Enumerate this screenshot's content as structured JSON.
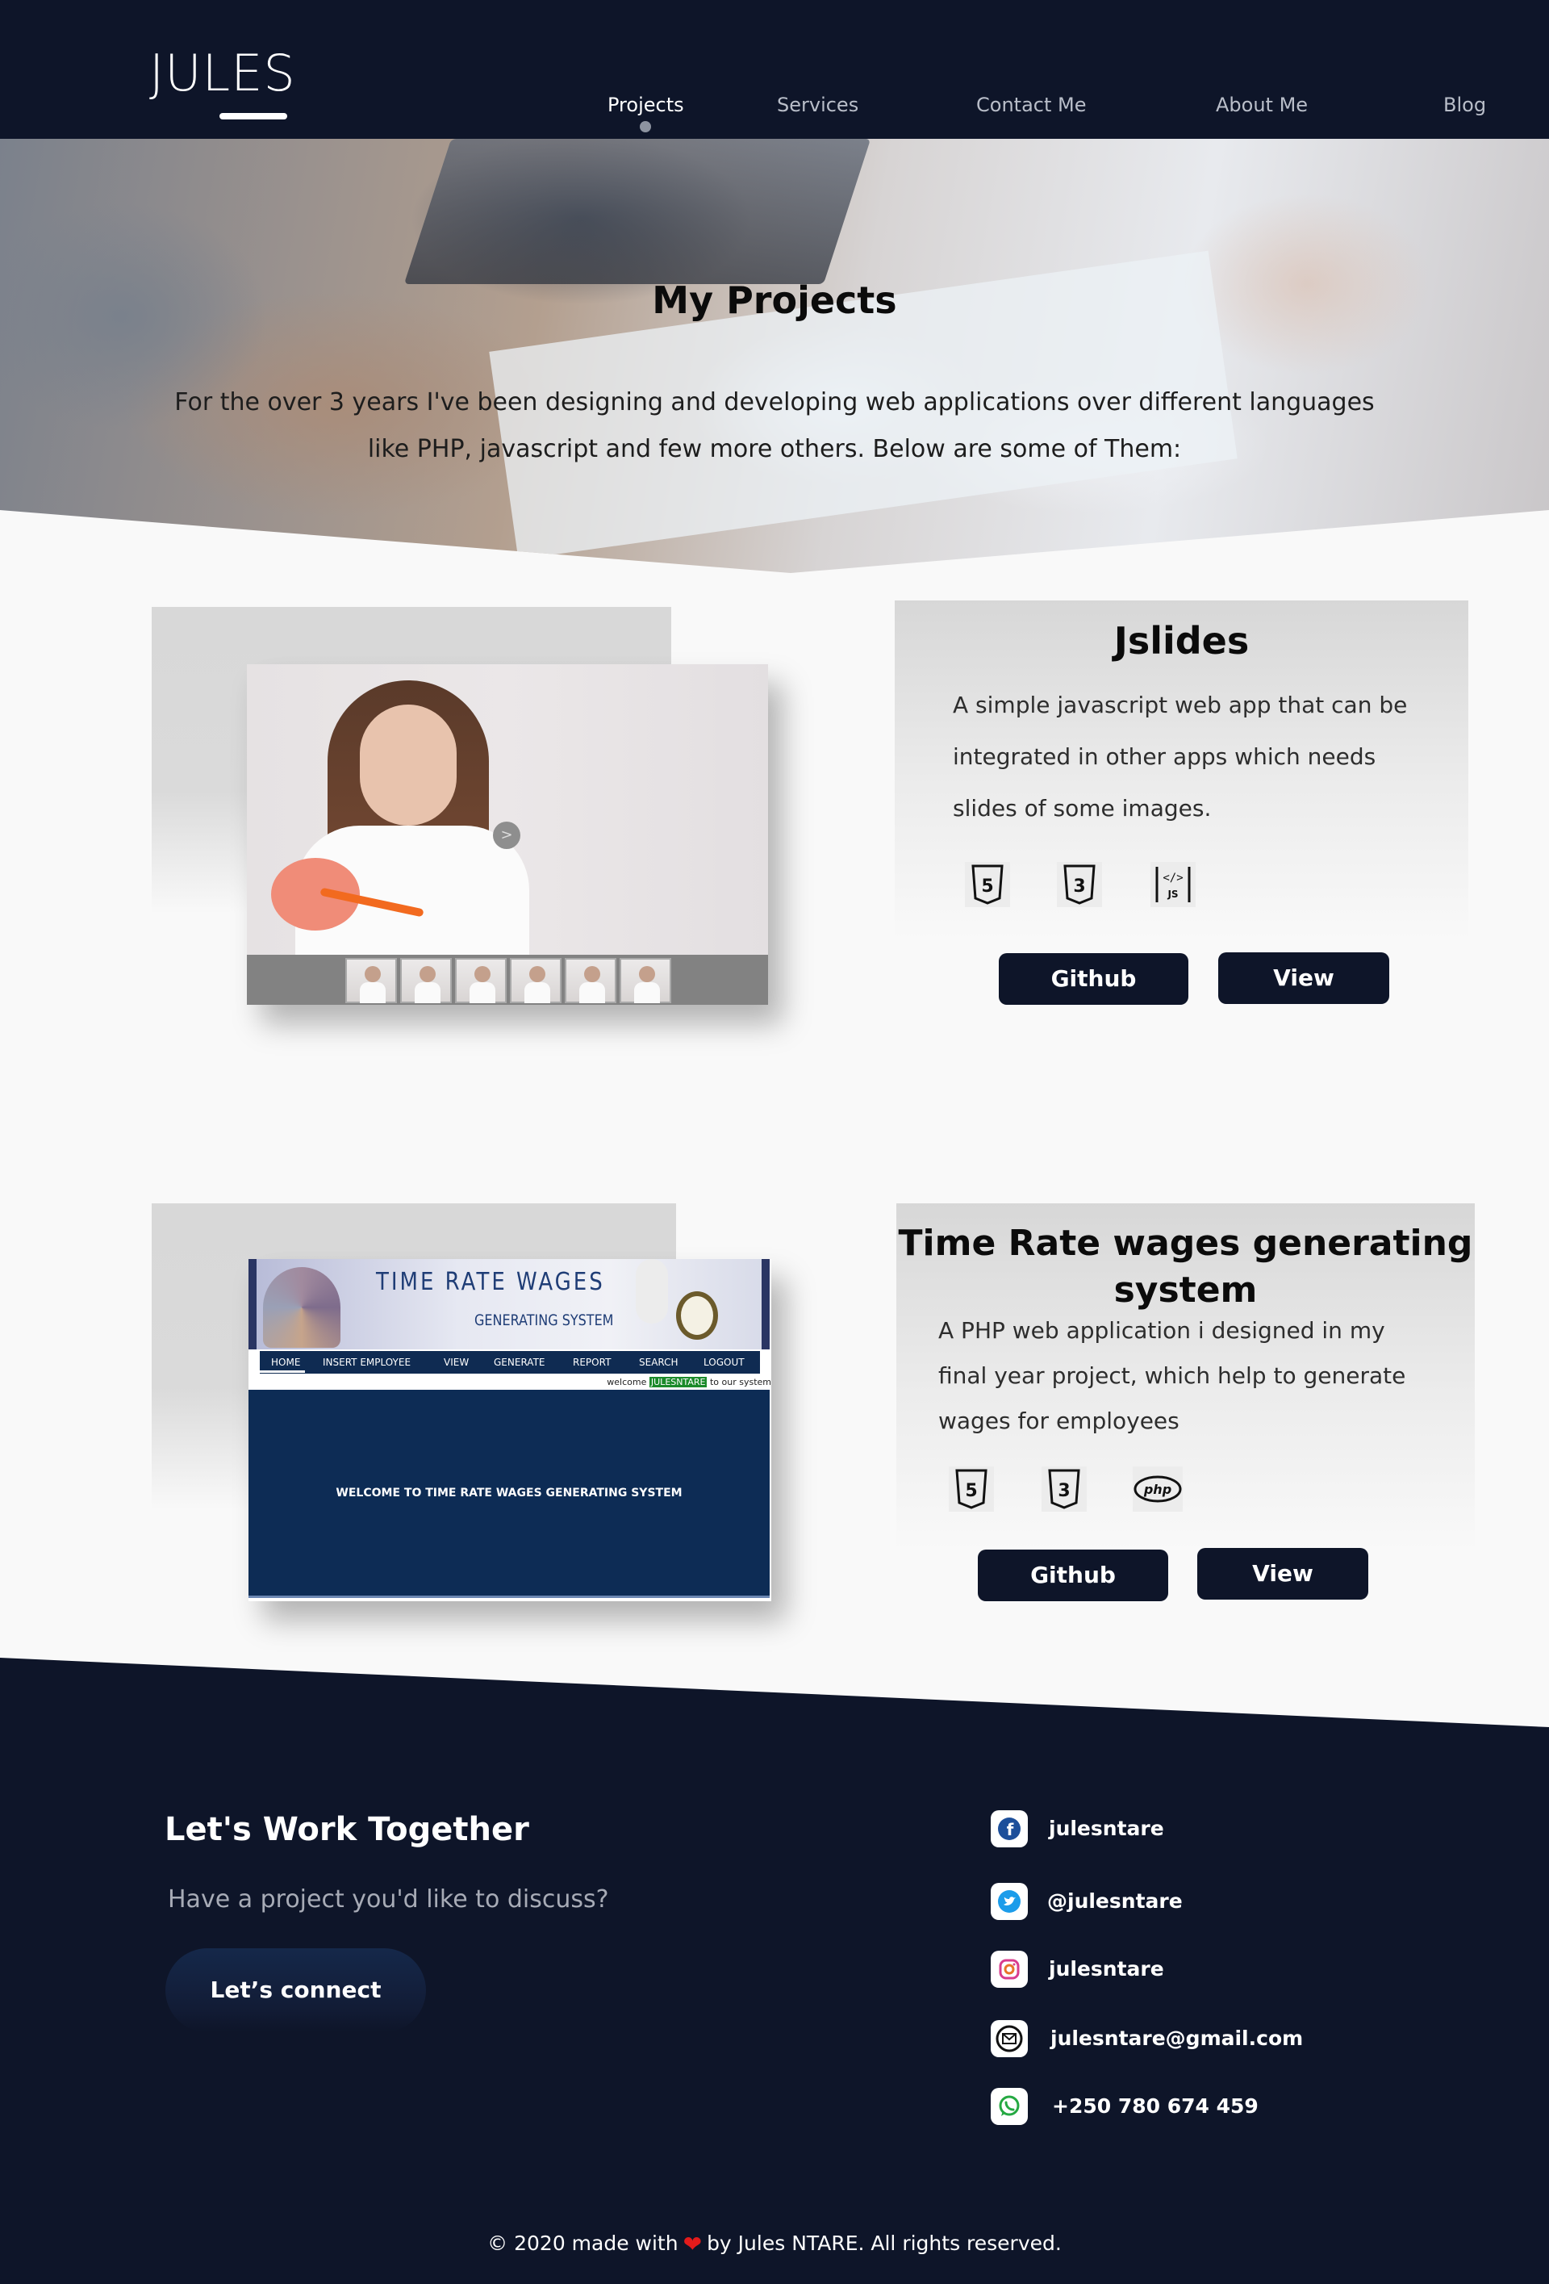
{
  "header": {
    "logo": "JULES",
    "nav": [
      {
        "label": "Projects",
        "active": true
      },
      {
        "label": "Services",
        "active": false
      },
      {
        "label": "Contact Me",
        "active": false
      },
      {
        "label": "About Me",
        "active": false
      },
      {
        "label": "Blog",
        "active": false
      }
    ]
  },
  "hero": {
    "title": "My Projects",
    "text_line1": "For the over 3 years I've been designing and developing web applications over different languages",
    "text_line2": "like PHP, javascript and few more others. Below are some of Them:"
  },
  "projects": [
    {
      "title": "Jslides",
      "description": [
        "A simple javascript web app that can be",
        "integrated in other apps which needs",
        "slides of some images."
      ],
      "tech": [
        "html5-icon",
        "css3-icon",
        "javascript-icon"
      ],
      "github_label": "Github",
      "view_label": "View"
    },
    {
      "title_line1": "Time Rate wages generating",
      "title_line2": "system",
      "description": [
        "A PHP web application i designed in my",
        "final year project, which help to generate",
        "wages for employees"
      ],
      "tech": [
        "html5-icon",
        "css3-icon",
        "php-icon"
      ],
      "github_label": "Github",
      "view_label": "View",
      "mockup": {
        "banner_title": "TIME   RATE   WAGES",
        "banner_subtitle": "GENERATING   SYSTEM",
        "nav": [
          "HOME",
          "INSERT EMPLOYEE",
          "VIEW",
          "GENERATE",
          "REPORT",
          "SEARCH",
          "LOGOUT"
        ],
        "welcome_prefix": "welcome",
        "welcome_user": "JULESNTARE",
        "welcome_suffix": "to our system",
        "main_text": "WELCOME TO TIME RATE WAGES GENERATING SYSTEM"
      }
    }
  ],
  "footer": {
    "cta_title": "Let's Work Together",
    "cta_subtitle": "Have a project you'd like to discuss?",
    "cta_button": "Let’s connect",
    "socials": [
      {
        "icon": "facebook-icon",
        "text": "julesntare"
      },
      {
        "icon": "twitter-icon",
        "text": "@julesntare"
      },
      {
        "icon": "instagram-icon",
        "text": "julesntare"
      },
      {
        "icon": "email-icon",
        "text": "julesntare@gmail.com"
      },
      {
        "icon": "whatsapp-icon",
        "text": "+250 780 674 459"
      }
    ],
    "copyright_before": "© 2020 made with",
    "copyright_after": "by Jules NTARE. All rights reserved."
  },
  "colors": {
    "navy": "#0e1529",
    "page_bg": "#f9f9f9",
    "heart": "#e31b1b"
  }
}
